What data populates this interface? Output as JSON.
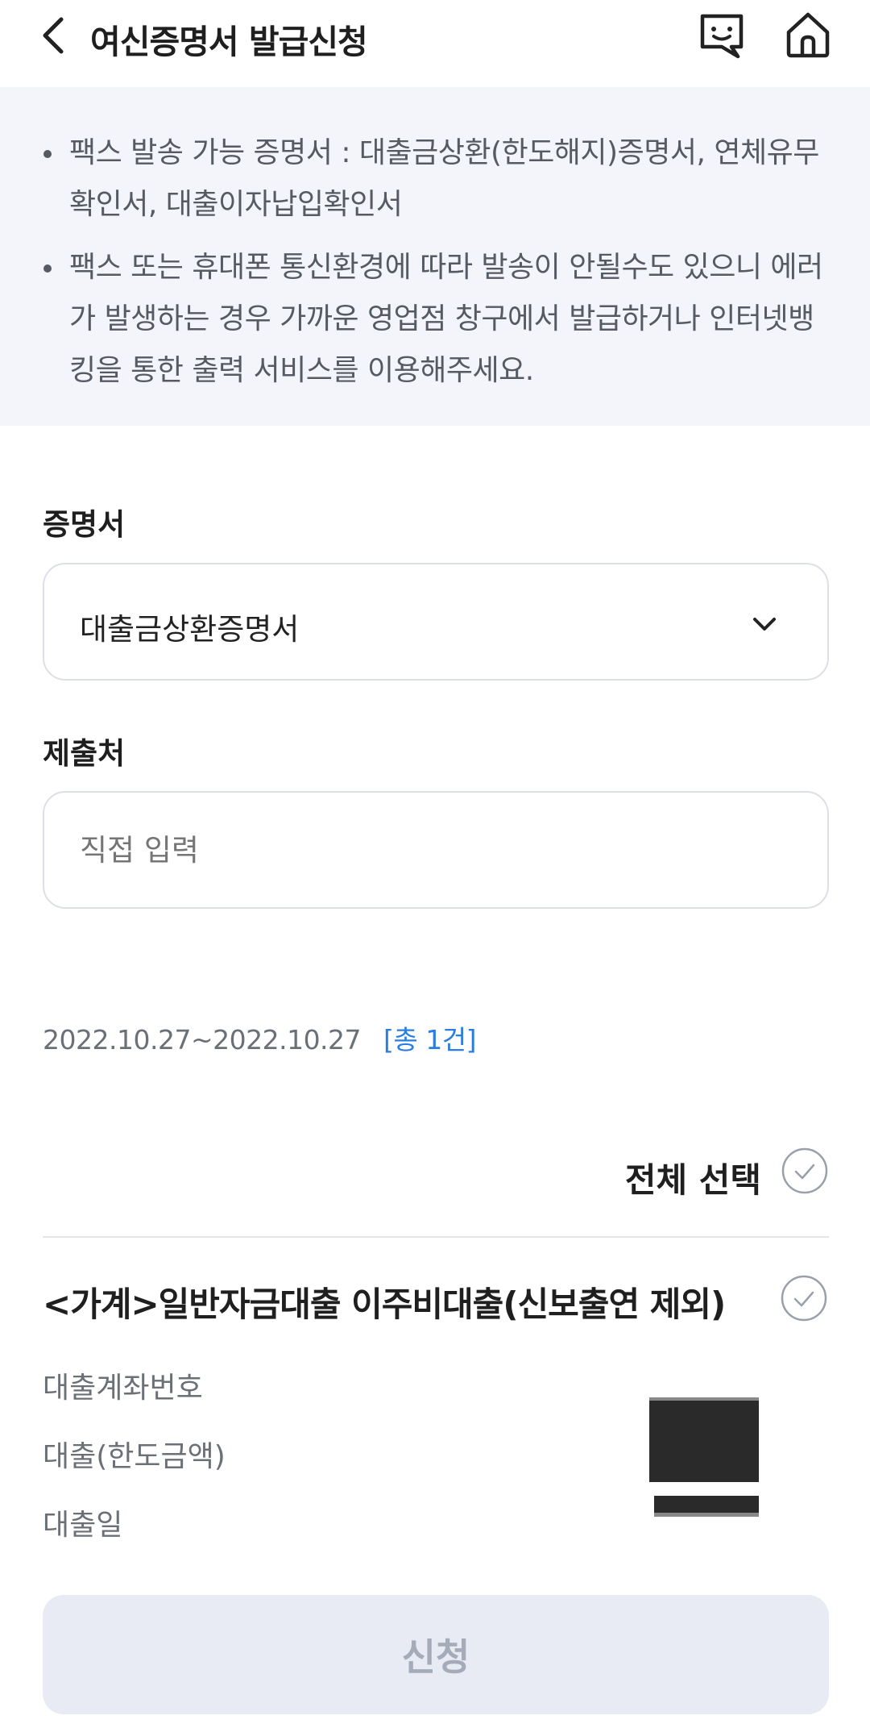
{
  "header": {
    "title": "여신증명서 발급신청"
  },
  "notice": {
    "items": [
      "팩스 발송 가능 증명서 : 대출금상환(한도해지)증명서, 연체유무 확인서, 대출이자납입확인서",
      "팩스 또는 휴대폰 통신환경에 따라 발송이 안될수도 있으니 에러가 발생하는 경우 가까운 영업점 창구에서 발급하거나 인터넷뱅킹을 통한 출력 서비스를 이용해주세요."
    ]
  },
  "form": {
    "certificate_label": "증명서",
    "certificate_value": "대출금상환증명서",
    "recipient_label": "제출처",
    "recipient_placeholder": "직접 입력",
    "recipient_value": ""
  },
  "period": {
    "range": "2022.10.27~2022.10.27",
    "count": "[총 1건]"
  },
  "list": {
    "select_all_label": "전체 선택",
    "loan": {
      "title": "<가계>일반자금대출 이주비대출(신보출연 제외)",
      "fields": [
        "대출계좌번호",
        "대출(한도금액)",
        "대출일"
      ]
    }
  },
  "footer": {
    "apply_label": "신청"
  },
  "colors": {
    "notice_bg": "#f3f5fa",
    "accent_blue": "#2a7de1",
    "button_disabled_bg": "#e8ebf3",
    "button_disabled_text": "#a5abb8"
  },
  "icons": {
    "back": "chevron-left-icon",
    "chat": "chatbot-icon",
    "home": "home-icon",
    "dropdown": "chevron-down-icon",
    "check": "check-circle-icon"
  }
}
